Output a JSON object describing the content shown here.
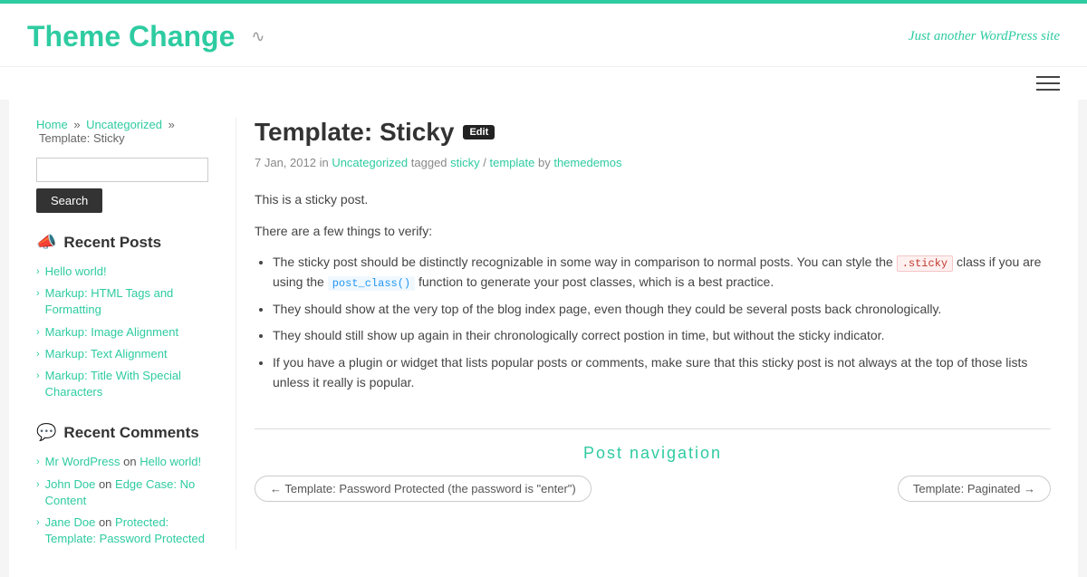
{
  "site": {
    "title": "Theme Change",
    "tagline": "Just another WordPress site"
  },
  "header": {
    "rss_symbol": "📡",
    "hamburger_label": "menu"
  },
  "breadcrumb": {
    "home": "Home",
    "separator": "»",
    "category": "Uncategorized",
    "current": "Template: Sticky"
  },
  "search": {
    "placeholder": "",
    "button_label": "Search"
  },
  "sidebar": {
    "recent_posts_title": "Recent Posts",
    "recent_posts_icon": "📣",
    "recent_posts": [
      {
        "title": "Hello world!"
      },
      {
        "title": "Markup: HTML Tags and Formatting"
      },
      {
        "title": "Markup: Image Alignment"
      },
      {
        "title": "Markup: Text Alignment"
      },
      {
        "title": "Markup: Title With Special Characters"
      }
    ],
    "recent_comments_title": "Recent Comments",
    "recent_comments_icon": "💬",
    "recent_comments": [
      {
        "author": "Mr WordPress",
        "connector": "on",
        "post": "Hello world!"
      },
      {
        "author": "John Doe",
        "connector": "on",
        "post": "Edge Case: No Content"
      },
      {
        "author": "Jane Doe",
        "connector": "on",
        "post": "Protected: Template: Password Protected"
      }
    ]
  },
  "post": {
    "title": "Template: Sticky",
    "edit_label": "Edit",
    "date": "7 Jan, 2012",
    "in_label": "in",
    "category": "Uncategorized",
    "tagged_label": "tagged",
    "tag1": "sticky",
    "tag_separator": "/",
    "tag2": "template",
    "by_label": "by",
    "author": "themedemos",
    "intro1": "This is a sticky post.",
    "intro2": "There are a few things to verify:",
    "bullets": [
      "The sticky post should be distinctly recognizable in some way in comparison to normal posts. You can style the .sticky class if you are using the post_class() function to generate your post classes, which is a best practice.",
      "They should show at the very top of the blog index page, even though they could be several posts back chronologically.",
      "They should still show up again in their chronologically correct postion in time, but without the sticky indicator.",
      "If you have a plugin or widget that lists popular posts or comments, make sure that this sticky post is not always at the top of those lists unless it really is popular."
    ],
    "sticky_code": ".sticky",
    "post_class_code": "post_class()"
  },
  "navigation": {
    "title": "Post navigation",
    "prev_label": "← Template: Password Protected (the password is \"enter\")",
    "next_label": "Template: Paginated →"
  }
}
